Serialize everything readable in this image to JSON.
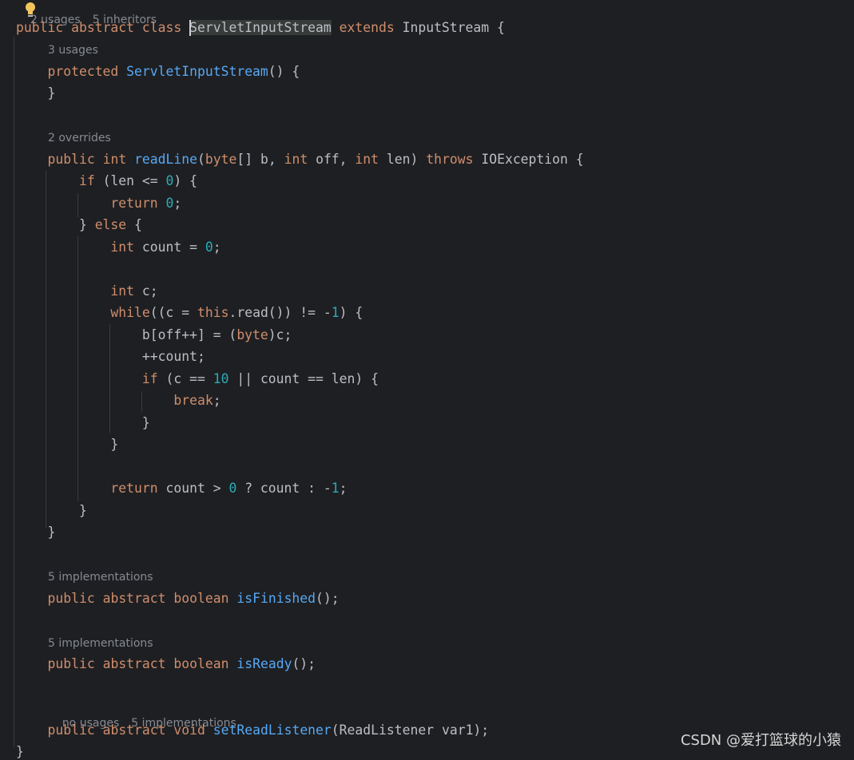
{
  "hints": {
    "class_usages": "2 usages",
    "class_inheritors": "5 inheritors",
    "ctor_usages": "3 usages",
    "readline_overrides": "2 overrides",
    "isfinished_impls": "5 implementations",
    "isready_impls": "5 implementations",
    "setlistener_usages": "no usages",
    "setlistener_impls": "5 implementations"
  },
  "code": {
    "public": "public",
    "abstract": "abstract",
    "class": "class",
    "class_name": "ServletInputStream",
    "extends": "extends",
    "super_name": "InputStream",
    "protected": "protected",
    "ctor_name": "ServletInputStream",
    "int": "int",
    "readline": "readLine",
    "byte": "byte",
    "throws": "throws",
    "ioexception": "IOException",
    "if": "if",
    "else": "else",
    "return": "return",
    "while": "while",
    "this": "this",
    "break": "break",
    "boolean": "boolean",
    "void": "void",
    "isfinished": "isFinished",
    "isready": "isReady",
    "setlistener": "setReadListener",
    "listener_type": "ReadListener",
    "zero": "0",
    "one": "1",
    "ten": "10"
  },
  "icons": {
    "intention_bulb": "lightbulb-icon"
  },
  "colors": {
    "background": "#1e1f22",
    "keyword": "#cf8e6d",
    "method": "#56a8f5",
    "number": "#2aacb8",
    "text": "#bcbec4",
    "hint": "#868a91"
  },
  "watermark": "CSDN @爱打篮球的小猿"
}
